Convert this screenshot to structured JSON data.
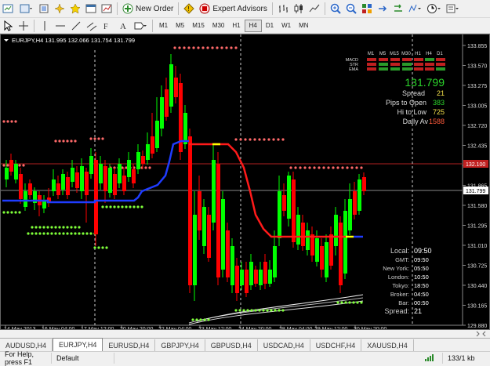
{
  "toolbar": {
    "new_order": "New Order",
    "expert_advisors": "Expert Advisors"
  },
  "timeframes": [
    "M1",
    "M5",
    "M15",
    "M30",
    "H1",
    "H4",
    "D1",
    "W1",
    "MN"
  ],
  "active_timeframe": "H4",
  "chart": {
    "header": "EURJPY,H4  131.995 132.066 131.754 131.799",
    "price_axis": [
      "133.855",
      "133.570",
      "133.275",
      "133.005",
      "132.720",
      "132.435",
      "132.150",
      "131.865",
      "131.580",
      "131.295",
      "131.010",
      "130.725",
      "130.440",
      "130.165",
      "129.880"
    ],
    "current_price_label": "131.799",
    "red_line_label": "132.100",
    "time_axis": [
      "14 May 2013",
      "16 May 04:00",
      "17 May 12:00",
      "20 May 20:00",
      "22 May 04:00",
      "23 May 12:00",
      "24 May 20:00",
      "28 May 04:00",
      "29 May 12:00",
      "30 May 20:00"
    ],
    "indicator_panel": {
      "columns": [
        "M1",
        "M5",
        "M15",
        "M30",
        "H1",
        "H4",
        "D1"
      ],
      "rows": [
        "MACD",
        "STR",
        "EMA"
      ],
      "price": "131.799",
      "spread_label": "Spread",
      "spread_value": "21",
      "pips_to_open_label": "Pips to Open",
      "pips_to_open_value": "383",
      "hi_to_low_label": "Hi to Low",
      "hi_to_low_value": "725",
      "daily_av_label": "Daily Av",
      "daily_av_value": "1588"
    },
    "clock_panel": {
      "rows": [
        {
          "label": "Local:",
          "value": "09:50"
        },
        {
          "label": "GMT:",
          "value": "09:50"
        },
        {
          "label": "New York:",
          "value": "05:50"
        },
        {
          "label": "London:",
          "value": "10:50"
        },
        {
          "label": "Tokyo:",
          "value": "18:50"
        },
        {
          "label": "Broker:",
          "value": "04:50"
        },
        {
          "label": "Bar:",
          "value": "00:50"
        },
        {
          "label": "Spread:",
          "value": "21"
        }
      ]
    },
    "colors": {
      "bull": "#00ff00",
      "bear": "#ff0000",
      "bg": "#000000",
      "ma_blue": "#1f3cff",
      "ma_red": "#ff1a1a",
      "support_dots": "#7fff3a",
      "resist_dots": "#ff6a6a"
    }
  },
  "tabs": [
    "AUDUSD,H4",
    "EURJPY,H4",
    "EURUSD,H4",
    "GBPJPY,H4",
    "GBPUSD,H4",
    "USDCAD,H4",
    "USDCHF,H4",
    "XAUUSD,H4"
  ],
  "active_tab": "EURJPY,H4",
  "status": {
    "help": "For Help, press F1",
    "profile": "Default",
    "traffic": "133/1 kb"
  }
}
